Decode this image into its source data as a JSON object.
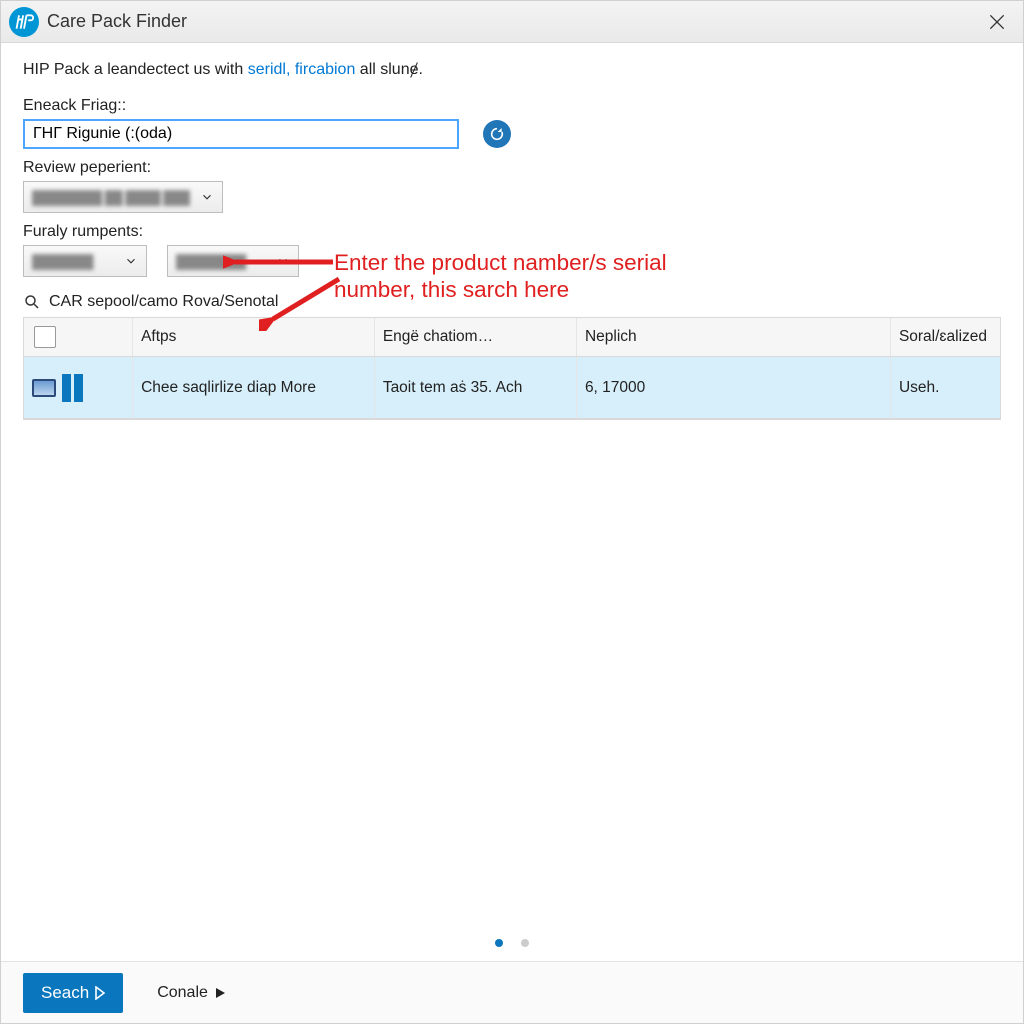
{
  "window": {
    "title": "Care Pack Finder"
  },
  "intro": {
    "pre": "HIP Pack a leandectect us with ",
    "link1": "seridl,",
    "link2": "fircabion",
    "post": " all slunɇ."
  },
  "search": {
    "label": "Eneack Friag::",
    "value": "ГHГ Rigunie (:(oda)"
  },
  "review": {
    "label": "Review peperient:"
  },
  "furaly": {
    "label": "Furaly rumpents:"
  },
  "section": {
    "title": "CAR sepool/camo Rova/Senotal"
  },
  "table": {
    "headers": {
      "a": "Aftps",
      "b": "Engë chatiom…",
      "c": "Neplich",
      "d": "Soral/ɛalized"
    },
    "row": {
      "a": "Chee saqlirlize diap More",
      "b": "Taoit tem aṡ 35. Ach",
      "c": "6, 17000",
      "d": "Useh."
    }
  },
  "annotation": {
    "text": "Enter the product namber/s serial number, this sarch here"
  },
  "footer": {
    "search": "Seach",
    "continue": "Conale"
  }
}
